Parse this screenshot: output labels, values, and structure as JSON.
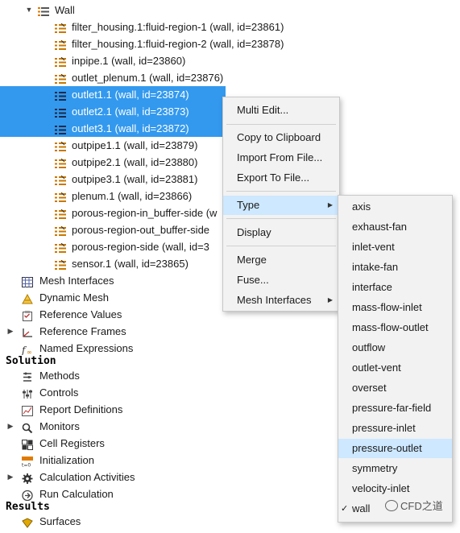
{
  "tree": {
    "wall_group": "Wall",
    "boundaries": [
      "filter_housing.1:fluid-region-1 (wall, id=23861)",
      "filter_housing.1:fluid-region-2 (wall, id=23878)",
      "inpipe.1 (wall, id=23860)",
      "outlet_plenum.1 (wall, id=23876)",
      "outlet1.1 (wall, id=23874)",
      "outlet2.1 (wall, id=23873)",
      "outlet3.1 (wall, id=23872)",
      "outpipe1.1 (wall, id=23879)",
      "outpipe2.1 (wall, id=23880)",
      "outpipe3.1 (wall, id=23881)",
      "plenum.1 (wall, id=23866)",
      "porous-region-in_buffer-side (w",
      "porous-region-out_buffer-side",
      "porous-region-side (wall, id=3",
      "sensor.1 (wall, id=23865)"
    ],
    "setup_items": [
      "Mesh Interfaces",
      "Dynamic Mesh",
      "Reference Values",
      "Reference Frames",
      "Named Expressions"
    ],
    "solution_header": "Solution",
    "solution_items": [
      "Methods",
      "Controls",
      "Report Definitions",
      "Monitors",
      "Cell Registers",
      "Initialization",
      "Calculation Activities",
      "Run Calculation"
    ],
    "results_header": "Results",
    "results_items": [
      "Surfaces"
    ]
  },
  "context_menu": {
    "multi_edit": "Multi Edit...",
    "copy": "Copy to Clipboard",
    "import": "Import From File...",
    "export": "Export To File...",
    "type": "Type",
    "display": "Display",
    "merge": "Merge",
    "fuse": "Fuse...",
    "mesh_interfaces": "Mesh Interfaces"
  },
  "type_submenu": {
    "items": [
      "axis",
      "exhaust-fan",
      "inlet-vent",
      "intake-fan",
      "interface",
      "mass-flow-inlet",
      "mass-flow-outlet",
      "outflow",
      "outlet-vent",
      "overset",
      "pressure-far-field",
      "pressure-inlet",
      "pressure-outlet",
      "symmetry",
      "velocity-inlet",
      "wall"
    ],
    "highlighted": "pressure-outlet",
    "checked": "wall",
    "check_mark": "✓"
  },
  "watermark": "CFD之道",
  "colors": {
    "selection": "#3399ee",
    "menu_hover": "#cde8ff",
    "menu_bg": "#f2f2f2"
  }
}
